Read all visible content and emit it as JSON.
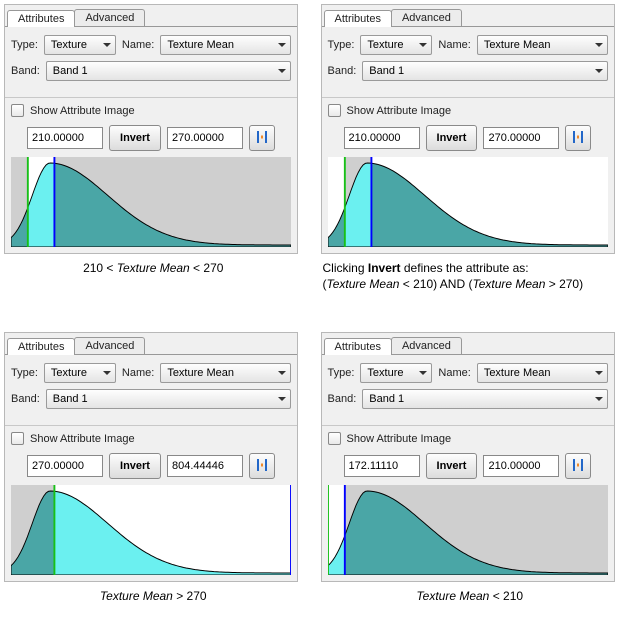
{
  "tabs": {
    "attributes": "Attributes",
    "advanced": "Advanced"
  },
  "labels": {
    "type": "Type:",
    "name": "Name:",
    "band": "Band:",
    "show_attr_img": "Show Attribute Image",
    "invert": "Invert"
  },
  "dropdowns": {
    "type_value": "Texture",
    "name_value": "Texture Mean",
    "band_value": "Band 1"
  },
  "colors": {
    "fill_sel": "#6bf0f0",
    "fill_unsel": "#4aa6a6",
    "gray_bg": "#cfcfcf",
    "green_line": "#18c018",
    "blue_line": "#0000ff"
  },
  "chart_data": [
    {
      "type": "area",
      "title": "Range selection 210–270",
      "xlim": [
        172,
        804
      ],
      "green_x": 210,
      "blue_x": 270,
      "inverted": false,
      "selection": [
        210,
        270
      ],
      "lower_input": "210.00000",
      "upper_input": "270.00000",
      "caption_parts": [
        "210 < ",
        "Texture Mean",
        " < 270"
      ]
    },
    {
      "type": "area",
      "title": "Inverted selection",
      "xlim": [
        172,
        804
      ],
      "green_x": 210,
      "blue_x": 270,
      "inverted": true,
      "selection": [
        210,
        270
      ],
      "lower_input": "210.00000",
      "upper_input": "270.00000",
      "caption_lines": [
        [
          "Clicking ",
          "**Invert**",
          " defines the attribute as:"
        ],
        [
          "(",
          "Texture Mean",
          " < 210) AND (",
          "Texture Mean",
          " > 270)"
        ]
      ]
    },
    {
      "type": "area",
      "title": "Greater-than selection",
      "xlim": [
        172,
        804
      ],
      "green_x": 270,
      "blue_x": 804,
      "inverted": false,
      "selection": [
        270,
        804
      ],
      "lower_input": "270.00000",
      "upper_input": "804.44446",
      "caption_parts": [
        "",
        "Texture Mean",
        " > 270"
      ]
    },
    {
      "type": "area",
      "title": "Less-than selection",
      "xlim": [
        172,
        804
      ],
      "green_x": 172,
      "blue_x": 210,
      "inverted": false,
      "selection": [
        172,
        210
      ],
      "lower_input": "172.11110",
      "upper_input": "210.00000",
      "caption_parts": [
        "",
        "Texture Mean",
        " < 210"
      ]
    }
  ]
}
